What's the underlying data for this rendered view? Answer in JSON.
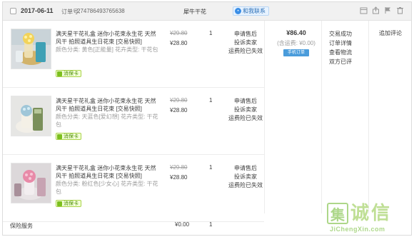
{
  "header": {
    "date": "2017-06-11",
    "order_no_label": "订单号:",
    "order_no": "274786493765638",
    "shop_name": "犀牛干花",
    "contact_label": "和我联系"
  },
  "items": [
    {
      "title": "满天星干花礼盒 迷你小花束永生花 天然风干 拍照道具生日花束 [交易快照]",
      "sku": "颜色分类: 黄色[正能量]  花卉类型: 干花包",
      "badge": "消保卡",
      "orig_price": "¥29.80",
      "price": "¥28.80",
      "qty": "1",
      "service": [
        "申请售后",
        "投诉卖家",
        "运费险已失效"
      ]
    },
    {
      "title": "满天星干花礼盒 迷你小花束永生花 天然风干 拍照道具生日花束 [交易快照]",
      "sku": "颜色分类: 天蓝色[爱幻想]  花卉类型: 干花包",
      "badge": "消保卡",
      "orig_price": "¥29.80",
      "price": "¥28.80",
      "qty": "1",
      "service": [
        "申请售后",
        "投诉卖家",
        "运费险已失效"
      ]
    },
    {
      "title": "满天星干花礼盒 迷你小花束永生花 天然风干 拍照道具生日花束 [交易快照]",
      "sku": "颜色分类: 粉红色[少女心]  花卉类型: 干花包",
      "badge": "消保卡",
      "orig_price": "¥29.80",
      "price": "¥28.80",
      "qty": "1",
      "service": [
        "申请售后",
        "投诉卖家",
        "运费险已失效"
      ]
    }
  ],
  "total": {
    "amount": "¥86.40",
    "shipping": "(含运费: ¥0.00)",
    "mobile_label": "手机订单"
  },
  "status": [
    "交易成功",
    "订单详情",
    "查看物流",
    "双方已评"
  ],
  "action": "追加评论",
  "footer": {
    "label": "保险服务",
    "price": "¥0.00",
    "qty": "1"
  },
  "watermark": {
    "chars": [
      "集",
      "诚",
      "信"
    ],
    "url": "JiChengXin.com"
  },
  "colors": {
    "header_bg": "#f1f1f1",
    "link_blue": "#2b6fb6",
    "watermark_green": "#6bb82a"
  },
  "icons": [
    "calendar-icon",
    "share-icon",
    "flag-icon",
    "delete-icon"
  ]
}
